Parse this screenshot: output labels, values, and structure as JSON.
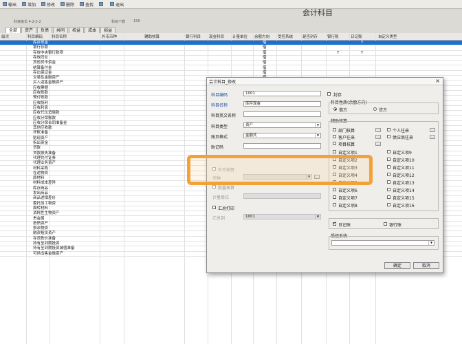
{
  "toolbar": {
    "items": [
      {
        "label": "输出",
        "icon": "print-icon"
      },
      {
        "label": "增加",
        "icon": "add-icon"
      },
      {
        "label": "修改",
        "icon": "edit-icon"
      },
      {
        "label": "删除",
        "icon": "delete-icon"
      },
      {
        "label": "查找",
        "icon": "search-icon"
      },
      {
        "label": "",
        "icon": "help-icon"
      },
      {
        "label": "退出",
        "icon": "exit-icon"
      }
    ]
  },
  "app": {
    "title": "会计科目",
    "code_rule_label": "科目级长  4-2-2-2",
    "count_label": "科目个数",
    "count_value": "156"
  },
  "tabs": [
    "全部",
    "资产",
    "负债",
    "共同",
    "权益",
    "成本",
    "损益"
  ],
  "grid": {
    "columns": [
      "级次",
      "科目编码",
      "科目名称",
      "外币币种",
      "辅助核算",
      "银行科目",
      "现金科目",
      "计量单位",
      "余额方向",
      "受控系统",
      "是否封存",
      "银行账",
      "日记账",
      "自定义类型"
    ],
    "rows": [
      {
        "name": "库存现金",
        "dir": "借",
        "bank": "",
        "diary": "Y",
        "sel": true
      },
      {
        "name": "银行存款",
        "dir": "借",
        "bank": "",
        "diary": ""
      },
      {
        "name": "存放中央银行款项",
        "dir": "借",
        "bank": "Y",
        "diary": "Y"
      },
      {
        "name": "存放同业",
        "dir": "借"
      },
      {
        "name": "其他货币资金",
        "dir": "借"
      },
      {
        "name": "结算备付金",
        "dir": "借"
      },
      {
        "name": "存出保证金",
        "dir": "借"
      },
      {
        "name": "交易性金融资产",
        "dir": "借"
      },
      {
        "name": "买入返售金融资产",
        "dir": "借"
      },
      {
        "name": "应收票据",
        "dir": "借"
      },
      {
        "name": "应收账款",
        "dir": "借"
      },
      {
        "name": "预付账款",
        "dir": "借"
      },
      {
        "name": "应收股利",
        "dir": "借"
      },
      {
        "name": "应收利息",
        "dir": "借"
      },
      {
        "name": "应收代位追偿款",
        "dir": "借"
      },
      {
        "name": "应收分保账款",
        "dir": "借"
      },
      {
        "name": "应收分保合同准备金",
        "dir": "借"
      },
      {
        "name": "其他应收款",
        "dir": "借"
      },
      {
        "name": "坏账准备",
        "dir": "贷"
      },
      {
        "name": "贴现资产",
        "dir": "借"
      },
      {
        "name": "拆出资金",
        "dir": "借"
      },
      {
        "name": "贷款",
        "dir": "借"
      },
      {
        "name": "贷款损失准备",
        "dir": "贷"
      },
      {
        "name": "代理兑付证券",
        "dir": "借"
      },
      {
        "name": "代理业务资产",
        "dir": "借"
      },
      {
        "name": "材料采购",
        "dir": "借"
      },
      {
        "name": "在途物资",
        "dir": "借"
      },
      {
        "name": "原材料",
        "dir": "借"
      },
      {
        "name": "材料成本差异",
        "dir": "借"
      },
      {
        "name": "库存商品",
        "dir": "借"
      },
      {
        "name": "发出商品",
        "dir": "借"
      },
      {
        "name": "商品进销差价",
        "dir": "贷"
      },
      {
        "name": "委托加工物资",
        "dir": "借"
      },
      {
        "name": "周转材料",
        "dir": "借"
      },
      {
        "name": "消耗性生物资产",
        "dir": "借"
      },
      {
        "name": "贵金属",
        "dir": "借"
      },
      {
        "name": "抵债资产",
        "dir": "借"
      },
      {
        "name": "损余物资",
        "dir": "借"
      },
      {
        "name": "融资租赁资产",
        "dir": "借"
      },
      {
        "name": "存货跌价准备",
        "dir": "贷"
      },
      {
        "name": "持有至到期投资",
        "dir": "借"
      },
      {
        "name": "持有至到期投资减值准备",
        "dir": "贷"
      },
      {
        "name": "可供出售金融资产",
        "dir": "借"
      }
    ]
  },
  "dialog": {
    "title": "会计科目_修改",
    "code_label": "科目编码",
    "code_value": "1001",
    "seal_label": "封存",
    "name_label": "科目名称",
    "name_value": "库存现金",
    "en_name_label": "科目英文名称",
    "type_label": "科目类型",
    "type_value": "资产",
    "format_label": "账页格式",
    "format_value": "金额式",
    "mnemonic_label": "助记码",
    "fx_label": "外币核算",
    "currency_label": "币种",
    "qty_label": "数量核算",
    "unit_label": "计量单位",
    "summary_label": "汇总打印",
    "summary_to_label": "汇总到",
    "summary_to_value": "1001",
    "dir_group_label": "科目性质(余额方向)",
    "debit_label": "借方",
    "credit_label": "贷方",
    "aux_group_label": "辅助核算",
    "aux": [
      "部门核算",
      "个人往来",
      "客户往来",
      "供应商往来",
      "项目核算"
    ],
    "custom_left": [
      "自定义项1",
      "自定义项2",
      "自定义项3",
      "自定义项4",
      "自定义项5",
      "自定义项6",
      "自定义项7",
      "自定义项8"
    ],
    "custom_right": [
      "自定义项9",
      "自定义项10",
      "自定义项11",
      "自定义项12",
      "自定义项13",
      "自定义项14",
      "自定义项15",
      "自定义项16"
    ],
    "diary_label": "日记账",
    "bank_label": "银行账",
    "control_label": "受控系统",
    "ok_label": "确定",
    "cancel_label": "取消"
  }
}
